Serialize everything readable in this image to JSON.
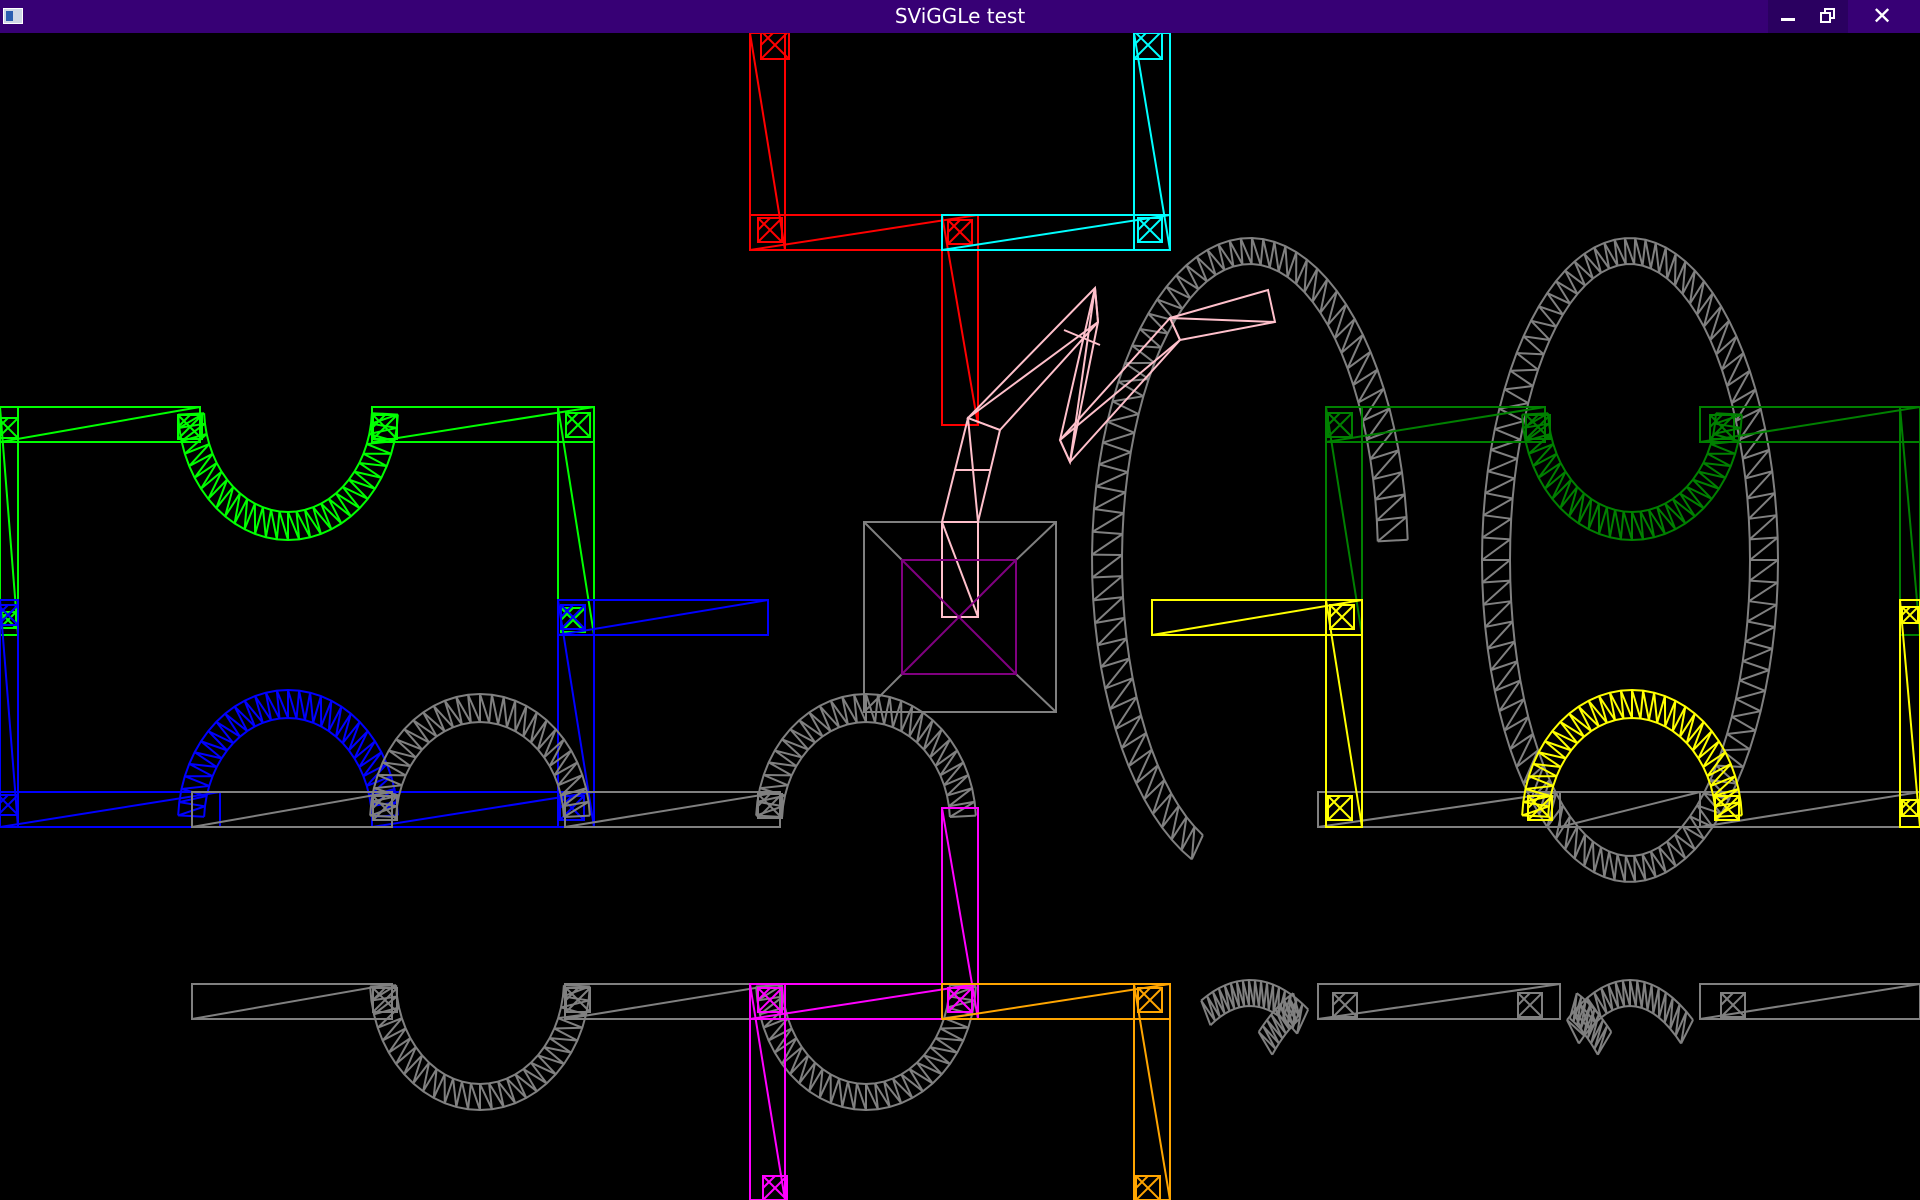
{
  "window": {
    "title": "SViGGLe test",
    "controls": {
      "minimize_icon": "minimize-icon",
      "maximize_icon": "restore-icon",
      "close_icon": "close-icon",
      "close_glyph": "✕"
    }
  },
  "scene": {
    "background": "#000000",
    "colors": {
      "red": "#ff0000",
      "cyan": "#00ffff",
      "green": "#00ff00",
      "blue": "#0000ff",
      "gray": "#808080",
      "pink": "#ffc0cb",
      "purple": "#800080",
      "magenta": "#ff00ff",
      "orange": "#ffa500",
      "yellow": "#ffff00",
      "dark_green": "#008000"
    }
  }
}
